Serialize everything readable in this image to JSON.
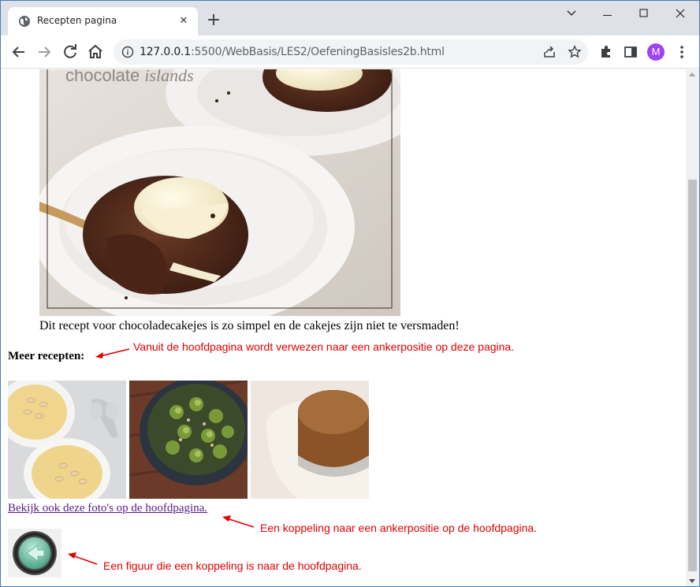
{
  "browser": {
    "tab_title": "Recepten pagina",
    "tab_close": "✕",
    "new_tab": "+",
    "url_host": "127.0.0.1",
    "url_path": ":5500/WebBasis/LES2/OefeningBasisles2b.html",
    "profile_initial": "M",
    "accent_color": "#a142f4"
  },
  "hero": {
    "overlay_text_plain": "chocolate",
    "overlay_text_script": "islands"
  },
  "content": {
    "caption": "Dit recept voor chocoladecakejes is zo simpel en de cakejes zijn niet te versmaden!",
    "heading": "Meer recepten:",
    "link_text": "Bekijk ook deze foto's op de hoofdpagina.",
    "link_color": "#551a8b"
  },
  "annotations": {
    "note_anchor": "Vanuit de hoofdpagina wordt verwezen naar een ankerpositie op deze pagina.",
    "note_link": "Een koppeling naar een ankerpositie op de hoofdpagina.",
    "note_figure": "Een figuur die een koppeling is naar de hoofdpagina.",
    "color": "#e00000"
  },
  "icons": {
    "tab_favicon": "globe-icon",
    "back": "arrow-left-icon",
    "forward": "arrow-right-icon",
    "reload": "reload-icon",
    "home": "home-icon",
    "site_info": "info-icon",
    "share": "share-icon",
    "bookmark": "star-icon",
    "extensions": "puzzle-icon",
    "side_panel": "side-panel-icon",
    "menu": "kebab-menu-icon",
    "back_figure": "back-arrow-button-icon"
  }
}
